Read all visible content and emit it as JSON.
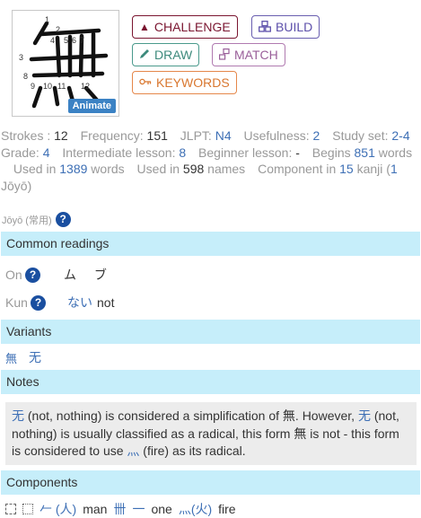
{
  "kanji": {
    "character": "無",
    "stroke_numbers": [
      "1",
      "2",
      "3",
      "4",
      "5",
      "6",
      "7",
      "8",
      "9",
      "10",
      "11",
      "12"
    ],
    "animate_label": "Animate"
  },
  "buttons": {
    "challenge": "CHALLENGE",
    "build": "BUILD",
    "draw": "DRAW",
    "match": "MATCH",
    "keywords": "KEYWORDS"
  },
  "info": {
    "strokes_label": "Strokes :",
    "strokes": "12",
    "frequency_label": "Frequency:",
    "frequency": "151",
    "jlpt_label": "JLPT:",
    "jlpt": "N4",
    "usefulness_label": "Usefulness:",
    "usefulness": "2",
    "study_set_label": "Study set:",
    "study_set": "2-4",
    "grade_label": "Grade:",
    "grade": "4",
    "intermediate_label": "Intermediate lesson:",
    "intermediate": "8",
    "beginner_label": "Beginner lesson:",
    "beginner": "-",
    "begins_label": "Begins",
    "begins_count": "851",
    "words_label": "words",
    "used_in_label": "Used in",
    "used_in_words": "1389",
    "words_label2": "words",
    "used_in_label2": "Used in",
    "used_in_names": "598",
    "names_label": "names",
    "component_in_label": "Component in",
    "component_in": "15",
    "kanji_label": "kanji",
    "joyo_paren_open": "(",
    "joyo_count": "1",
    "joyo_word": "Jōyō)"
  },
  "joyo_tag": "Jōyō (常用)",
  "help_glyph": "?",
  "common_readings": {
    "title": "Common readings",
    "on_label": "On",
    "on_value": "ム ブ",
    "kun_label": "Kun",
    "kun_value": "ない",
    "kun_meaning": "not"
  },
  "variants": {
    "title": "Variants",
    "items": [
      "無",
      "无"
    ]
  },
  "notes": {
    "title": "Notes",
    "t1": "无",
    "t2": " (not, nothing) is considered a simplification of 無. However, ",
    "t3": "无",
    "t4": " (not, nothing) is usually classified as a radical, this form 無 is not - this form is considered to use ",
    "t5": "灬",
    "t6": " (fire) as its radical."
  },
  "components": {
    "title": "Components",
    "c1_glyph": "𠂉",
    "c1_paren": "(人)",
    "c1_meaning": "man",
    "c2_glyph": "卌",
    "c3_glyph": "一",
    "c3_meaning": "one",
    "c4_glyph": "灬",
    "c4_paren": "(火)",
    "c4_meaning": "fire"
  }
}
